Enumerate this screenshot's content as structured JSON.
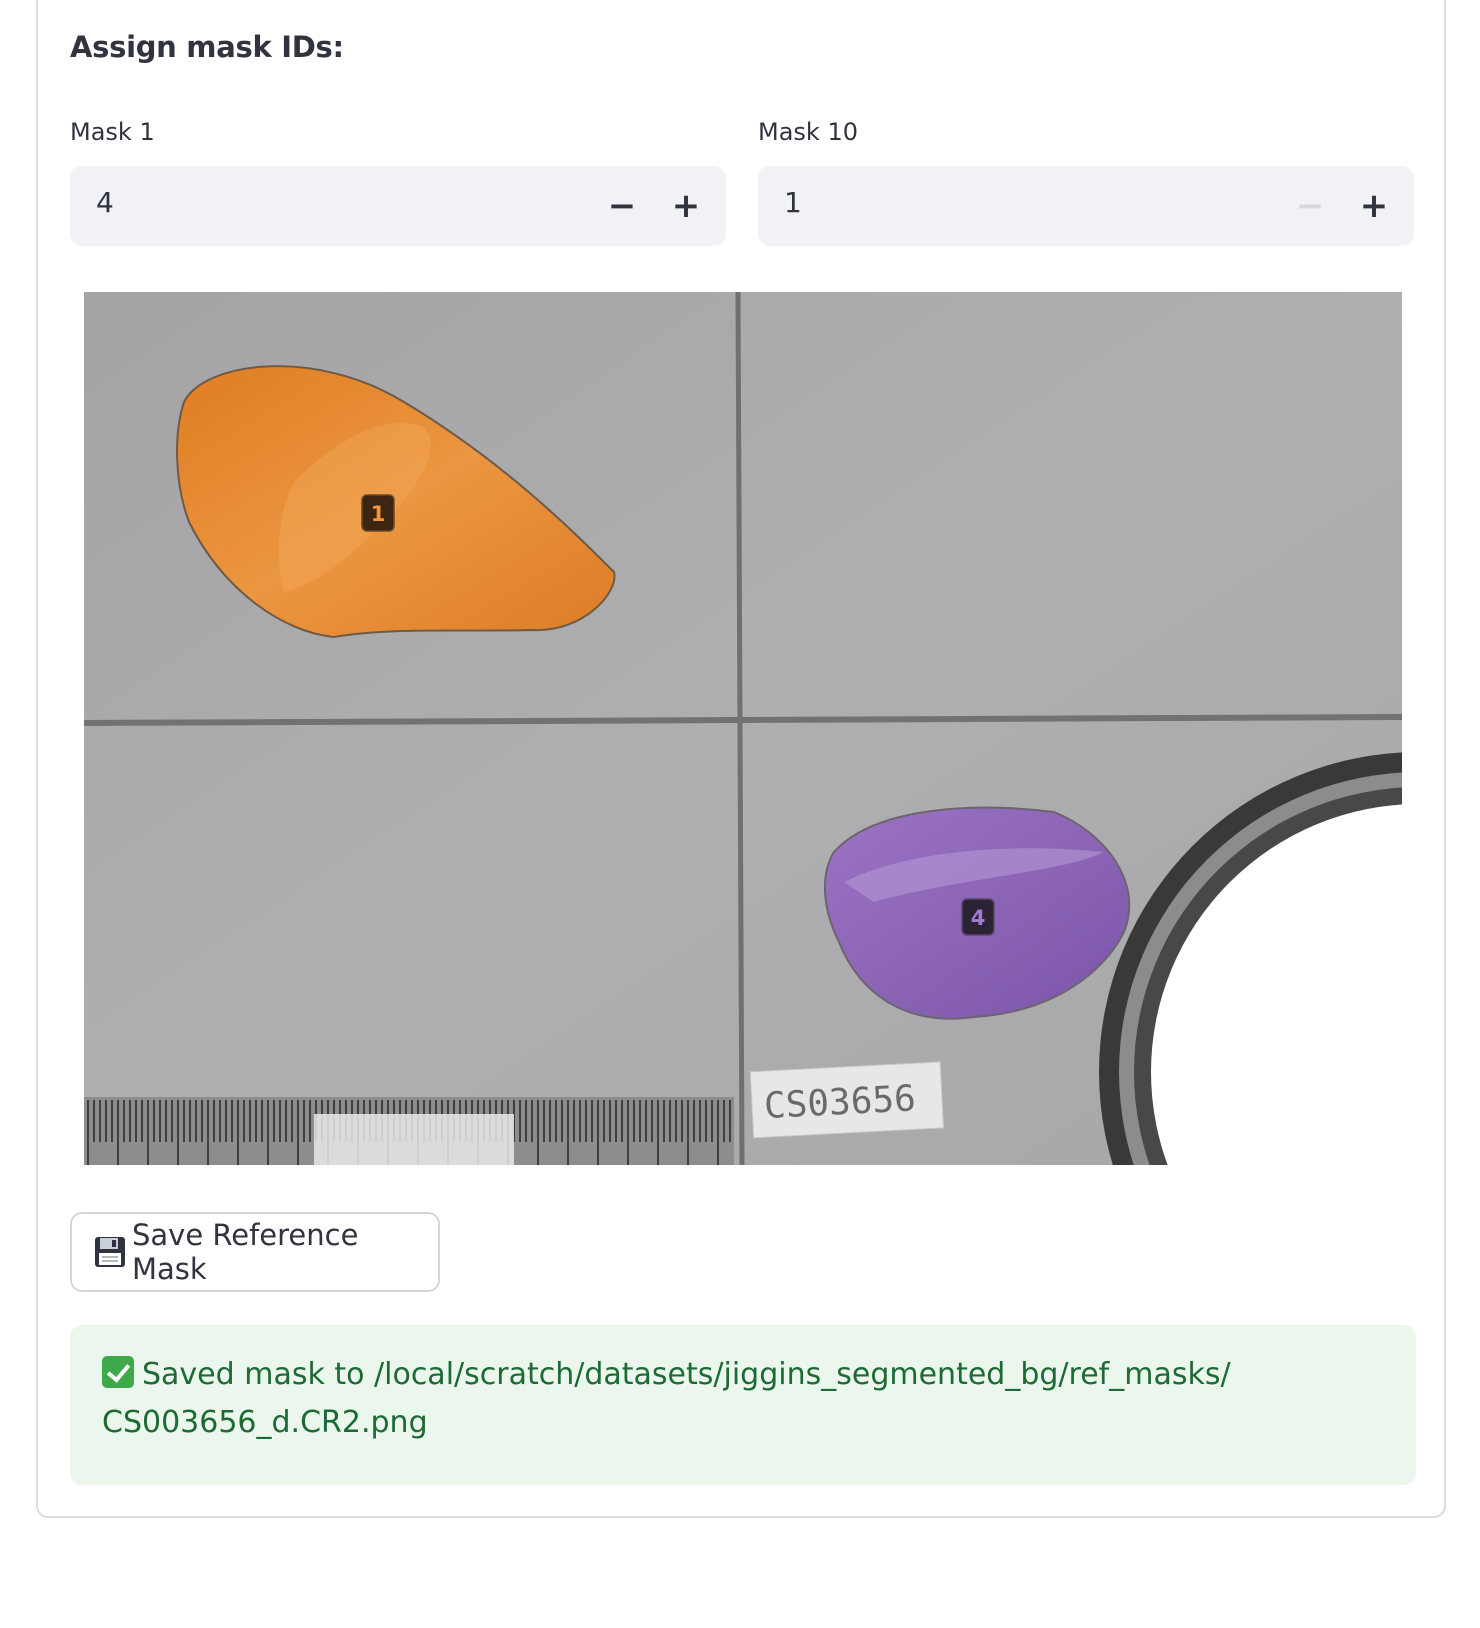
{
  "section": {
    "heading": "Assign mask IDs:"
  },
  "inputs": [
    {
      "label": "Mask 1",
      "value": "4",
      "decrement": "−",
      "increment": "+",
      "decrement_disabled": false
    },
    {
      "label": "Mask 10",
      "value": "1",
      "decrement": "−",
      "increment": "+",
      "decrement_disabled": true
    }
  ],
  "image": {
    "masks": [
      {
        "id_label": "1",
        "color": "#e88a2e"
      },
      {
        "id_label": "4",
        "color": "#8a5fb3"
      }
    ],
    "specimen_tag": "CS03656"
  },
  "save_button": {
    "icon": "floppy-disk-icon",
    "label": "Save Reference Mask"
  },
  "alert": {
    "icon": "check-mark-icon",
    "message": "Saved mask to /local/scratch/datasets/jiggins_segmented_bg/ref_masks/",
    "message_line2": "CS003656_d.CR2.png",
    "color": "#1d6b34"
  }
}
